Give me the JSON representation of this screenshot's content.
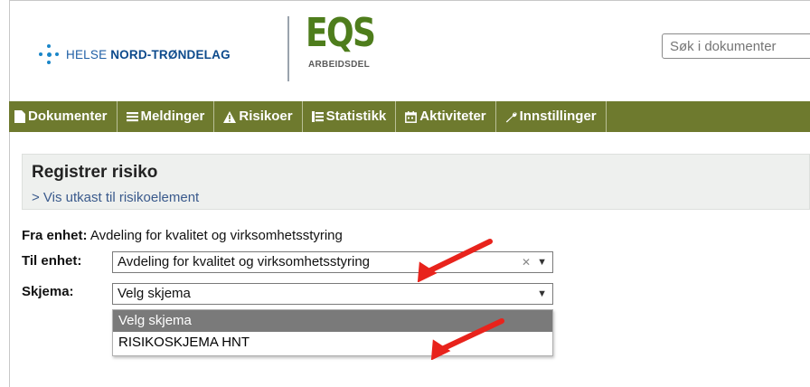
{
  "header": {
    "org_name_light": "HELSE",
    "org_name_bold": "NORD-TRØNDELAG",
    "product_title": "EQS",
    "product_subtitle": "ARBEIDSDEL",
    "search_placeholder": "Søk i dokumenter"
  },
  "nav": [
    {
      "label": "Dokumenter",
      "icon": "document-icon"
    },
    {
      "label": "Meldinger",
      "icon": "list-icon"
    },
    {
      "label": "Risikoer",
      "icon": "warning-icon"
    },
    {
      "label": "Statistikk",
      "icon": "chart-icon"
    },
    {
      "label": "Aktiviteter",
      "icon": "calendar-icon"
    },
    {
      "label": "Innstillinger",
      "icon": "wrench-icon"
    }
  ],
  "panel": {
    "title": "Registrer risiko",
    "link": "> Vis utkast til risikoelement"
  },
  "form": {
    "from_label": "Fra enhet:",
    "from_value": "Avdeling for kvalitet og virksomhetsstyring",
    "to_label": "Til enhet:",
    "to_value": "Avdeling for kvalitet og virksomhetsstyring",
    "schema_label": "Skjema:",
    "schema_value": "Velg skjema",
    "schema_options": [
      "Velg skjema",
      "RISIKOSKJEMA HNT"
    ]
  },
  "colors": {
    "nav_bg": "#6e7a2e",
    "brand_green": "#4e7d1c",
    "brand_blue": "#1f5fa6",
    "annotation_arrow": "#e8231c"
  }
}
